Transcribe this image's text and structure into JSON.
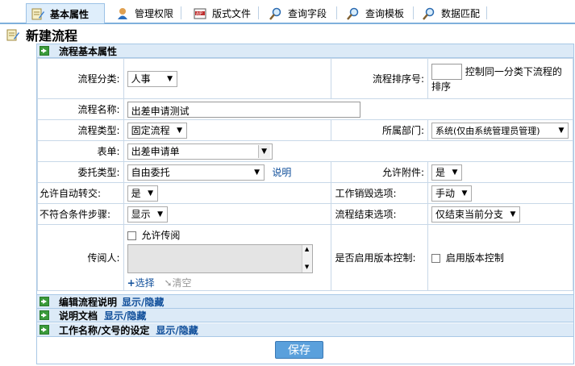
{
  "tabs": [
    {
      "label": "基本属性",
      "icon": "edit-icon",
      "active": true
    },
    {
      "label": "管理权限",
      "icon": "user-icon"
    },
    {
      "label": "版式文件",
      "icon": "aip-icon"
    },
    {
      "label": "查询字段",
      "icon": "magnifier-icon"
    },
    {
      "label": "查询模板",
      "icon": "magnifier-icon"
    },
    {
      "label": "数据匹配",
      "icon": "magnifier-icon"
    }
  ],
  "page_title": "新建流程",
  "sections": {
    "basic": "流程基本属性",
    "edit_desc": "编辑流程说明",
    "doc": "说明文档",
    "work_name": "工作名称/文号的设定"
  },
  "toggle_link": "显示/隐藏",
  "fields": {
    "category_label": "流程分类:",
    "category_value": "人事",
    "sort_label": "流程排序号:",
    "sort_value": "",
    "sort_hint": "控制同一分类下流程的排序",
    "name_label": "流程名称:",
    "name_value": "出差申请测试",
    "type_label": "流程类型:",
    "type_value": "固定流程",
    "dept_label": "所属部门:",
    "dept_value": "系统(仅由系统管理员管理)",
    "form_label": "表单:",
    "form_value": "出差申请单",
    "delegate_label": "委托类型:",
    "delegate_value": "自由委托",
    "delegate_link": "说明",
    "attach_label": "允许附件:",
    "attach_value": "是",
    "autotrans_label": "允许自动转交:",
    "autotrans_value": "是",
    "destroy_label": "工作销毁选项:",
    "destroy_value": "手动",
    "nomatch_label": "不符合条件步骤:",
    "nomatch_value": "显示",
    "end_label": "流程结束选项:",
    "end_value": "仅结束当前分支",
    "reader_label": "传阅人:",
    "allow_read_label": "允许传阅",
    "select_link": "选择",
    "clear_link": "清空",
    "version_label": "是否启用版本控制:",
    "version_check_label": "启用版本控制"
  },
  "save_label": "保存",
  "colors": {
    "tab_active_bg": "#dfeefb",
    "section_header_bg": "#dceaf7",
    "link": "#0f4e9a",
    "save_button": "#5aa0dc"
  }
}
